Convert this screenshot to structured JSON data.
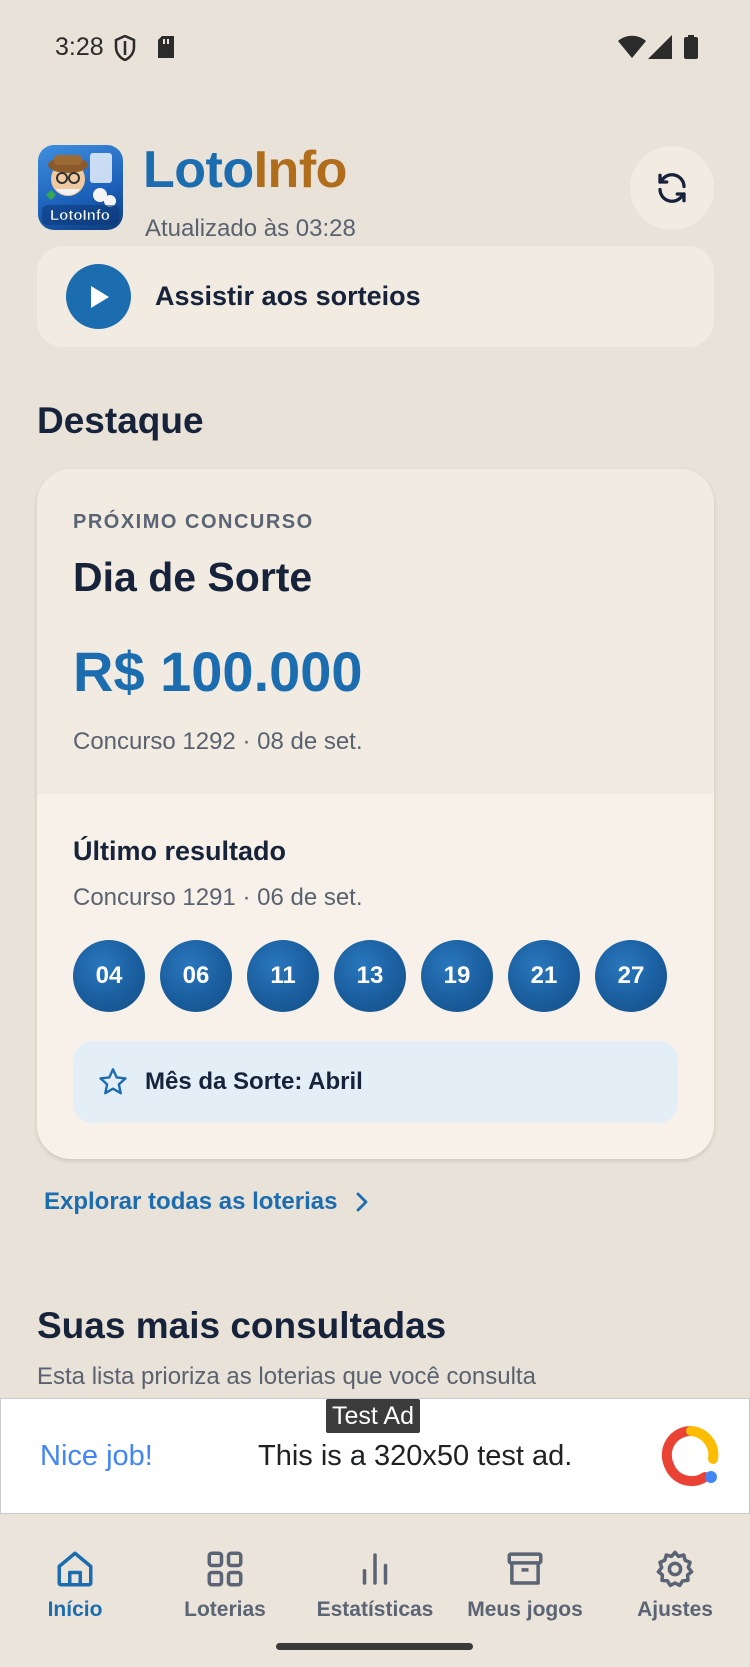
{
  "status_bar": {
    "time": "3:28"
  },
  "header": {
    "title_part1": "Loto",
    "title_part2": "Info",
    "updated": "Atualizado às 03:28",
    "logo_text": "LotoInfo"
  },
  "watch_banner": {
    "label": "Assistir aos sorteios"
  },
  "highlight": {
    "section_title": "Destaque",
    "kicker": "PRÓXIMO CONCURSO",
    "lottery_name": "Dia de Sorte",
    "prize": "R$ 100.000",
    "next_draw": "Concurso 1292 · 08 de set.",
    "last_result_title": "Último resultado",
    "last_draw": "Concurso 1291 · 06 de set.",
    "numbers": [
      "04",
      "06",
      "11",
      "13",
      "19",
      "21",
      "27"
    ],
    "lucky_month": "Mês da Sorte: Abril"
  },
  "explore_link": "Explorar todas as loterias",
  "most_viewed": {
    "title": "Suas mais consultadas",
    "subtitle": "Esta lista prioriza as loterias que você consulta"
  },
  "ad": {
    "tag": "Test Ad",
    "nice": "Nice job!",
    "text": "This is a 320x50 test ad."
  },
  "bottom_nav": {
    "items": [
      {
        "label": "Início",
        "icon": "home-icon",
        "active": true
      },
      {
        "label": "Loterias",
        "icon": "grid-icon",
        "active": false
      },
      {
        "label": "Estatísticas",
        "icon": "bar-chart-icon",
        "active": false
      },
      {
        "label": "Meus jogos",
        "icon": "archive-icon",
        "active": false
      },
      {
        "label": "Ajustes",
        "icon": "gear-icon",
        "active": false
      }
    ]
  },
  "colors": {
    "primary": "#1c6cb0",
    "accent": "#b06e1c",
    "background": "#e8e2d8",
    "card": "#f1ebe2"
  }
}
